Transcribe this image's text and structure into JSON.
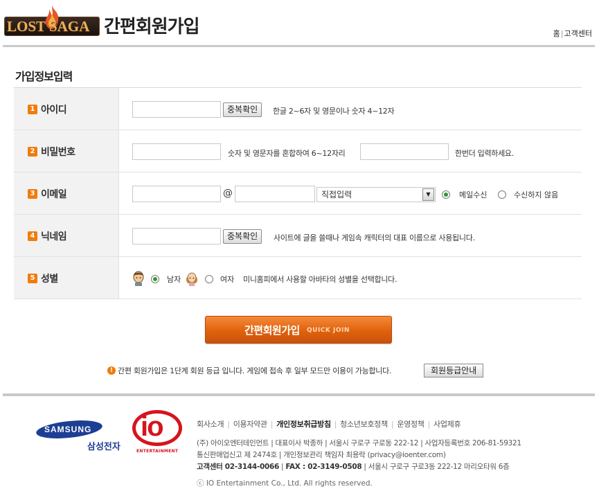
{
  "header": {
    "logo_text": "LOST SAGA",
    "page_heading": "간편회원가입",
    "links": {
      "home": "홈",
      "separator": "|",
      "support": "고객센터"
    }
  },
  "form": {
    "section_title": "가입정보입력",
    "rows": [
      {
        "num": "1",
        "label": "아이디"
      },
      {
        "num": "2",
        "label": "비밀번호"
      },
      {
        "num": "3",
        "label": "이메일"
      },
      {
        "num": "4",
        "label": "닉네임"
      },
      {
        "num": "5",
        "label": "성별"
      }
    ],
    "id": {
      "value": "",
      "check_button": "중복확인",
      "help": "한글 2~6자 및 영문이나 숫자 4~12자"
    },
    "password": {
      "value": "",
      "help": "숫자 및 영문자를 혼합하여 6~12자리",
      "confirm_value": "",
      "confirm_help": "한번더 입력하세요."
    },
    "email": {
      "local_value": "",
      "at": "@",
      "domain_value": "",
      "select_value": "직접입력",
      "receive_label": "메일수신",
      "no_receive_label": "수신하지 않음",
      "receive_checked": true
    },
    "nickname": {
      "value": "",
      "check_button": "중복확인",
      "help": "사이트에 글을 쓸때나 게임속 캐릭터의 대표 이름으로 사용됩니다."
    },
    "gender": {
      "male_label": "남자",
      "female_label": "여자",
      "male_checked": true,
      "help": "미니홈피에서 사용할 아바타의 성별을 선택합니다."
    }
  },
  "quick_join": {
    "main": "간편회원가입",
    "sub": "QUICK JOIN"
  },
  "notice": {
    "icon": "!",
    "text": "간편 회원가입은 1단계 회원 등급 입니다. 게임에 접속 후 일부 모드만 이용이 가능합니다.",
    "button": "회원등급안내"
  },
  "footer": {
    "samsung_word": "SAMSUNG",
    "samsung_korean": "삼성전자",
    "io_logo": "io",
    "io_sub": "ENTERTAINMENT",
    "links": [
      "회사소개",
      "이용자약관",
      "개인정보취급방침",
      "청소년보호정책",
      "운영정책",
      "사업제휴"
    ],
    "info_line1": "(주) 아이오엔터테인먼트 | 대표이사 박종하 | 서울시 구로구 구로동 222-12 | 사업자등록번호 206-81-59321",
    "info_line2": "통신판매업신고 제 2474호 | 개인정보관리 책임자 최용락 (privacy@ioenter.com)",
    "info_line3_strong": "고객센터 02-3144-0066",
    "info_line3_sep": " | ",
    "info_line3_fax": "FAX : 02-3149-0508",
    "info_line3_rest": " | 서울시 구로구 구로3동 222-12 마리오타워 6층",
    "copyright": "ⓒ IO Entertainment Co., Ltd. All rights reserved."
  },
  "colors": {
    "accent": "#f07c0a",
    "button_orange": "#e0620d",
    "samsung_blue": "#1c3f94",
    "io_red": "#d6141c",
    "radio_check": "#2b9b2b"
  }
}
